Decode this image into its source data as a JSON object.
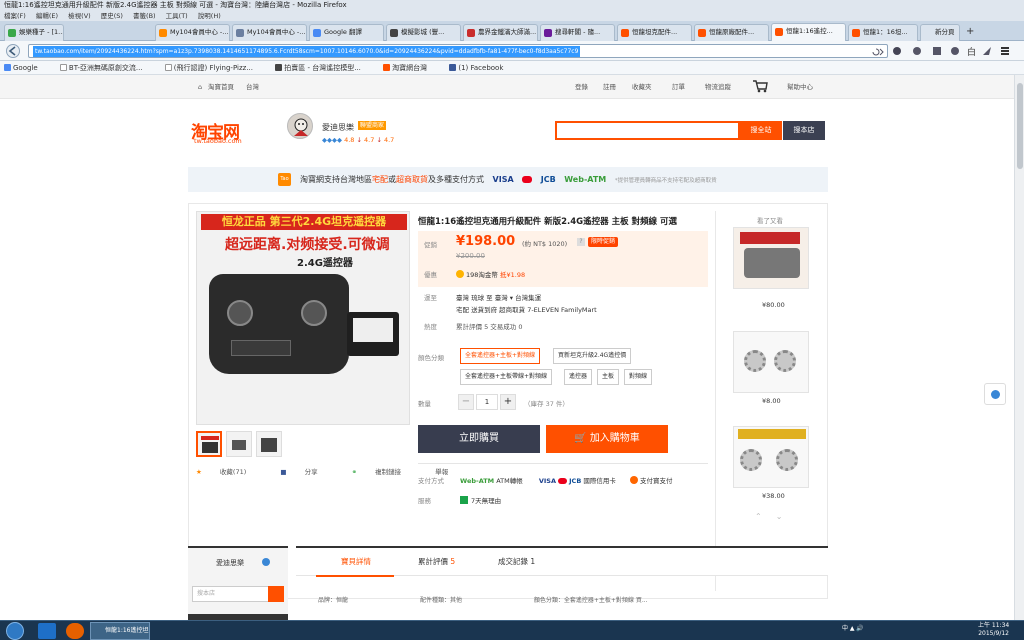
{
  "window": {
    "title": "恒龍1:16遙控坦克通用升級配件 新版2.4G遙控器 主板 對頻線 可選 - 淘寶台灣：陸續台灣店 - Mozilla Firefox"
  },
  "menubar": [
    "檔案(F)",
    "編輯(E)",
    "檢視(V)",
    "歷史(S)",
    "書籤(B)",
    "工具(T)",
    "說明(H)"
  ],
  "tabs": [
    {
      "label": "娛樂種子 - [1..."
    },
    {
      "label": "My104會員中心 -..."
    },
    {
      "label": "Google 翻譯"
    },
    {
      "label": "模擬影城 (豐..."
    },
    {
      "label": "農界金鐵滿大師滿..."
    },
    {
      "label": "搜尋軒閣 - 隨..."
    },
    {
      "label": "恒龍坦克配件..."
    },
    {
      "label": "恒龍原廠配件..."
    },
    {
      "label": "恒龍1:16遙控..."
    },
    {
      "label": "恒龍1：16坦..."
    },
    {
      "label": "新分頁"
    }
  ],
  "urlbar": {
    "url": "tw.taobao.com/item/20924436224.htm?spm=a1z3p.7398038.1414651174895.6.Fcrdt58scm=1007.10146.6070.0&id=20924436224&pvid=ddadfbfb-fa81-477f-bec0-f8d3aa5c77c9"
  },
  "bookmarks": [
    "Google",
    "BT-亞洲無碼原創交流...",
    "(飛行認證) Flying-Pizz...",
    "拍賣區 - 台灣遙控模型...",
    "淘寶網台灣",
    "(1) Facebook"
  ],
  "topnav": {
    "home": "淘寶首頁",
    "region": "台灣",
    "login": "登錄",
    "register": "註冊",
    "favorites": "收藏夾",
    "orders": "訂單",
    "logistics": "物流追蹤",
    "help": "幫助中心"
  },
  "header": {
    "logo": "淘宝网",
    "logo_sub": "tw.taobao.com",
    "shop_name": "愛迪思樂",
    "shop_badge": "聯盟商家",
    "ratings": [
      "4.8",
      "4.7",
      "4.7"
    ],
    "search_all": "搜全站",
    "search_shop": "搜本店"
  },
  "banner": {
    "text_a": "淘寶網支持台灣地區",
    "text_home": "宅配",
    "text_or": "或",
    "text_store": "超商取貨",
    "text_b": "及多種支付方式",
    "pay_visa": "VISA",
    "pay_jcb": "JCB",
    "pay_webatm": "Web-ATM",
    "note": "*提供管理員轉商品不支持宅配及超商取貨"
  },
  "product": {
    "image_headline": "恒龙正品 第三代2.4G坦克遥控器",
    "image_subline": "超远距离.对频接受.可微调",
    "image_subline2": "2.4G遥控器",
    "title": "恒龍1:16遙控坦克通用升級配件 新版2.4G遙控器 主板 對頻線 可選",
    "price_label": "促銷",
    "price": "¥198.00",
    "price_ntd": "(約 NT$ 1020)",
    "price_tag": "限時促銷",
    "old_price": "¥200.00",
    "promo_label": "優惠",
    "promo_text": "198淘金幣",
    "promo_value": "抵¥1.98",
    "ship_label": "運至",
    "ship_text": "臺灣 琉球 至 臺灣 ▾    台灣集運",
    "ship_methods": "宅配    送貨到府    超商取貨    7-ELEVEN    FamilyMart",
    "sales_label": "熱度",
    "sales_text": "累計評價 5   交易成功 0",
    "color_label": "顏色分類",
    "options": [
      "全套遙控器+主板+對頻線",
      "買新坦克升級2.4G遙控價",
      "全套遙控器+主板帶線+對頻線",
      "遙控器",
      "主板",
      "對頻線"
    ],
    "qty_label": "數量",
    "qty": "1",
    "stock": "（庫存 37 件）",
    "buy_now": "立即購買",
    "add_cart": "加入購物車",
    "pay_label": "支付方式",
    "pay_webatm": "Web-ATM",
    "pay_atm": "ATM轉帳",
    "pay_card": "國際信用卡",
    "pay_alipay": "支付寶支付",
    "service_label": "服務",
    "service_text": "7天無理由"
  },
  "actions": {
    "favorite": "收藏(71)",
    "share": "分享",
    "copy_link": "複制鏈接",
    "report": "舉報"
  },
  "side": {
    "title": "看了又看",
    "prices": [
      "¥80.00",
      "¥8.00",
      "¥38.00"
    ]
  },
  "bottom": {
    "shop_name": "愛迪思樂",
    "search_placeholder": "搜本店",
    "tabs": [
      {
        "label": "寶貝詳情",
        "count": ""
      },
      {
        "label": "累計評價",
        "count": "5"
      },
      {
        "label": "成交記錄",
        "count": "1"
      }
    ],
    "specs": [
      "品牌：恒龍",
      "配件種類：其他",
      "顏色分類：全套遙控器+主板+對頻線 買..."
    ]
  },
  "taskbar": {
    "task_label": "恒龍1:16遙控坦...",
    "tray_text": "中 ▲ 🔊",
    "time": "上午 11:34",
    "date": "2015/9/12"
  },
  "colors": {
    "accent": "#ff5000",
    "dark": "#383d4f",
    "price": "#ff4400"
  }
}
